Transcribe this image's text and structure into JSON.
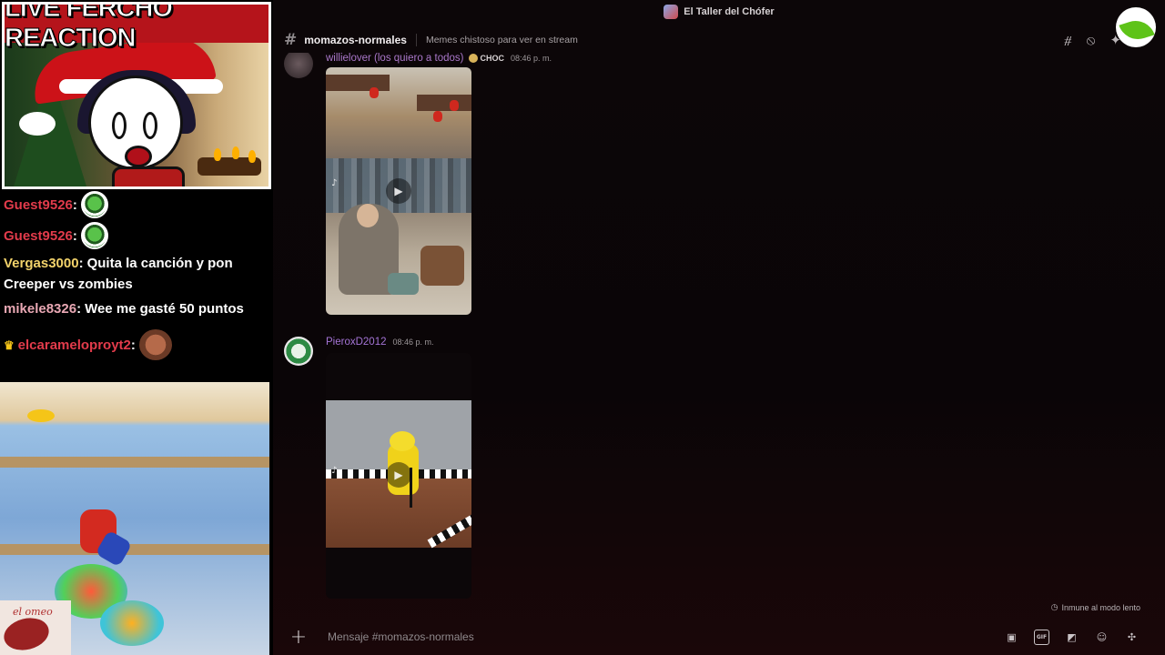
{
  "stream": {
    "title": "LIVE FERCHO REACTION",
    "chat": [
      {
        "user": "Guest9526",
        "text": "",
        "emote": "green-globe-emote"
      },
      {
        "user": "Guest9526",
        "text": "",
        "emote": "green-globe-emote"
      },
      {
        "user": "Vergas3000",
        "text": "Quita la canción y pon Creeper vs zombies"
      },
      {
        "user": "mikele8326",
        "text": "Wee me gasté 50 puntos"
      },
      {
        "user": "elcarameloproyt2",
        "text": "",
        "emote": "monkey-emote",
        "badge": "crown-icon"
      }
    ],
    "corner_logo_text": "el omeo"
  },
  "discord": {
    "server_name": "El Taller del Chófer",
    "channel": {
      "name": "momazos-normales",
      "topic": "Memes chistoso para ver en stream"
    },
    "header_icons": [
      "threads-icon",
      "mute-icon",
      "pin-icon"
    ],
    "messages": [
      {
        "username": "willielover (los quiero a todos)",
        "tag": "CHOC",
        "time": "08:46 p. m.",
        "attachment": "video"
      },
      {
        "username": "PieroxD2012",
        "time": "08:46 p. m.",
        "attachment": "video"
      }
    ],
    "slowmode_text": "Inmune al modo lento",
    "composer": {
      "placeholder": "Mensaje #momazos-normales",
      "icons": [
        "gift-icon",
        "gif-icon",
        "sticker-icon",
        "emoji-icon",
        "apps-icon"
      ]
    }
  },
  "colors": {
    "username_purple": "#a977c9",
    "chat_red": "#e23b4b",
    "chat_yellow": "#f3d36b",
    "title_red": "#b5141b"
  }
}
